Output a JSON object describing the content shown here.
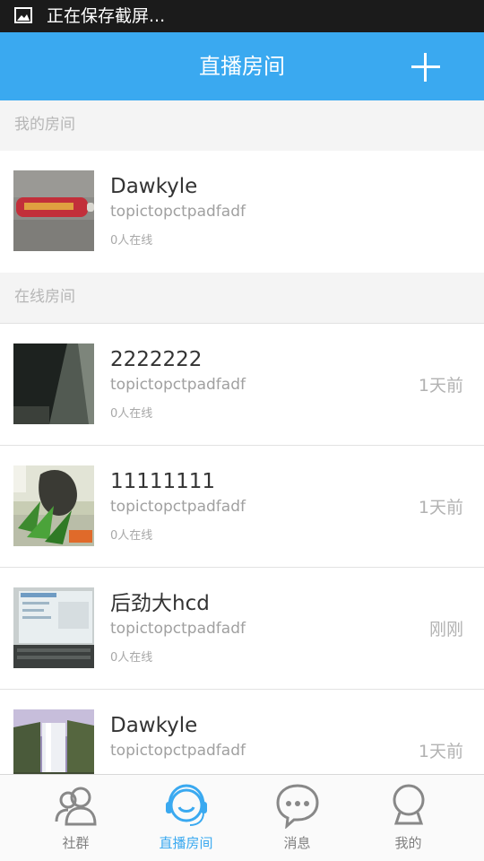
{
  "status_bar": {
    "text": "正在保存截屏...",
    "icon": "image-icon"
  },
  "header": {
    "title": "直播房间",
    "add_icon": "plus-icon"
  },
  "sections": {
    "my_rooms": "我的房间",
    "online_rooms": "在线房间"
  },
  "my_rooms": [
    {
      "name": "Dawkyle",
      "topic": "topictopctpadfadf",
      "online": "0人在线",
      "time": "",
      "thumb": "red-object-photo"
    }
  ],
  "online_rooms": [
    {
      "name": "2222222",
      "topic": "topictopctpadfadf",
      "online": "0人在线",
      "time": "1天前",
      "thumb": "dark-room-photo"
    },
    {
      "name": "11111111",
      "topic": "topictopctpadfadf",
      "online": "0人在线",
      "time": "1天前",
      "thumb": "plant-photo"
    },
    {
      "name": "后劲大hcd",
      "topic": "topictopctpadfadf",
      "online": "0人在线",
      "time": "刚刚",
      "thumb": "laptop-screen-photo"
    },
    {
      "name": "Dawkyle",
      "topic": "topictopctpadfadf",
      "online": "",
      "time": "1天前",
      "thumb": "waterfall-photo"
    }
  ],
  "tabs": [
    {
      "label": "社群",
      "icon": "community-icon",
      "active": false
    },
    {
      "label": "直播房间",
      "icon": "headset-icon",
      "active": true
    },
    {
      "label": "消息",
      "icon": "message-icon",
      "active": false
    },
    {
      "label": "我的",
      "icon": "user-icon",
      "active": false
    }
  ],
  "colors": {
    "accent": "#3aa9f0",
    "status_bar": "#1b1b1b",
    "section_bg": "#f4f4f4",
    "tab_inactive": "#808080"
  }
}
